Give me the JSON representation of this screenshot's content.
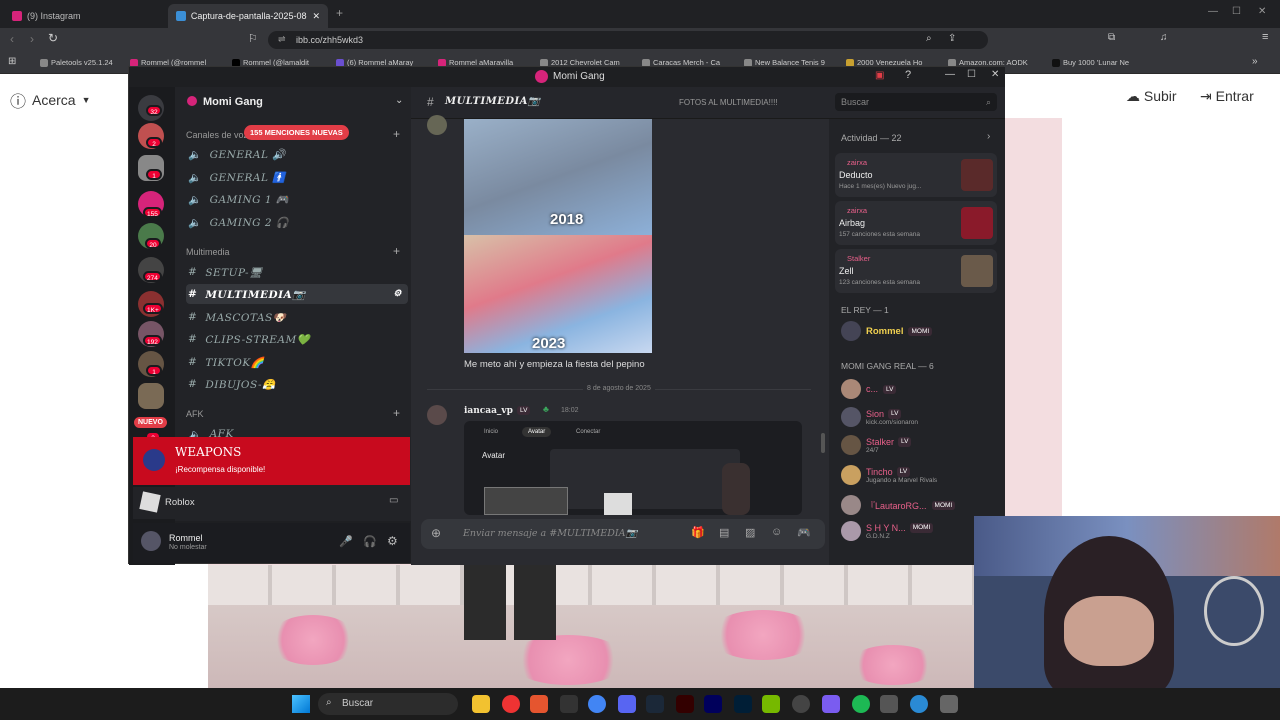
{
  "browser": {
    "tabs": [
      {
        "label": "(9) Instagram"
      },
      {
        "label": "Captura-de-pantalla-2025-08-0"
      }
    ],
    "url": "ibb.co/zhh5wkd3",
    "bookmarks": [
      "Paletools v25.1.24",
      "Rommel (@rommel",
      "Rommel (@lamaldit",
      "(6) Rommel aMaray",
      "Rommel aMaravilla",
      "2012 Chevrolet Cam",
      "Caracas Merch - Ca",
      "New Balance Tenis 9",
      "2000 Venezuela Ho",
      "Amazon.com: AODK",
      "Buy 1000 'Lunar Ne"
    ]
  },
  "page": {
    "acerca": "Acerca",
    "subir": "Subir",
    "entrar": "Entrar"
  },
  "discord": {
    "window_title": "Momi Gang",
    "server_name": "Momi Gang",
    "mentions_pill": "155 MENCIONES NUEVAS",
    "voice_category": "Canales de voz",
    "guild_badges": [
      "32",
      "2",
      "1",
      "155",
      "20",
      "274",
      "1K+",
      "192",
      "1",
      "3"
    ],
    "nuevo": "NUEVO",
    "voice_channels": [
      "GENERAL 🔊",
      "GENERAL 🚹",
      "GAMING 1 🎮",
      "GAMING 2 🎧"
    ],
    "multimedia_category": "Multimedia",
    "text_channels": [
      "SETUP-🖥",
      "MULTIMEDIA📷",
      "MASCOTAS🐶",
      "CLIPS-STREAM💚",
      "TIKTOK🌈",
      "DIBUJOS-😤"
    ],
    "afk_category": "AFK",
    "afk_channel": "AFK",
    "banner_title": "WEAPONS",
    "banner_sub": "¡Recompensa disponible!",
    "activity_app": "Roblox",
    "user_name": "Rommel",
    "user_status": "No molestar",
    "channel_title": "MULTIMEDIA📷",
    "channel_topic": "FOTOS AL MULTIMEDIA!!!!",
    "search_placeholder": "Buscar",
    "image_years": [
      "2018",
      "2023"
    ],
    "message_text": "Me meto ahí y empieza la fiesta del pepino",
    "date_divider": "8 de agosto de 2025",
    "msg2_author": "iancaa_vp",
    "msg2_time": "18:02",
    "embed": {
      "nav": [
        "Inicio",
        "Avatar",
        "Conectar"
      ],
      "title": "Avatar"
    },
    "input_placeholder": "Enviar mensaje a #MULTIMEDIA📷",
    "activity_header": "Actividad — 22",
    "activities": [
      {
        "user": "zairxa",
        "game": "Deducto",
        "detail": "Hace 1 mes(es)  Nuevo jug..."
      },
      {
        "user": "zairxa",
        "game": "Airbag",
        "detail": "157 canciones esta semana"
      },
      {
        "user": "Stalker",
        "game": "Zell",
        "detail": "123 canciones esta semana"
      }
    ],
    "group1": "EL REY — 1",
    "rey": {
      "name": "Rommel",
      "tag": "MOMI"
    },
    "group2": "MOMI GANG REAL — 6",
    "members": [
      {
        "name": "c...",
        "tag": "LV",
        "sub": ""
      },
      {
        "name": "Sion",
        "tag": "LV",
        "sub": "kick.com/sionaron"
      },
      {
        "name": "Stalker",
        "tag": "LV",
        "sub": "24/7"
      },
      {
        "name": "Tincho",
        "tag": "LV",
        "sub": "Jugando a Marvel Rivals"
      },
      {
        "name": "『LautaroRG...",
        "tag": "MOMI",
        "sub": ""
      },
      {
        "name": "S H Y N...",
        "tag": "MOMI",
        "sub": "G.D.N.Z"
      }
    ]
  },
  "taskbar": {
    "search": "Buscar"
  },
  "colors": {
    "discord_accent": "#e23d47",
    "banner_red": "#c80a1e",
    "member_pink": "#e8608a",
    "rey_gold": "#f0d050"
  }
}
